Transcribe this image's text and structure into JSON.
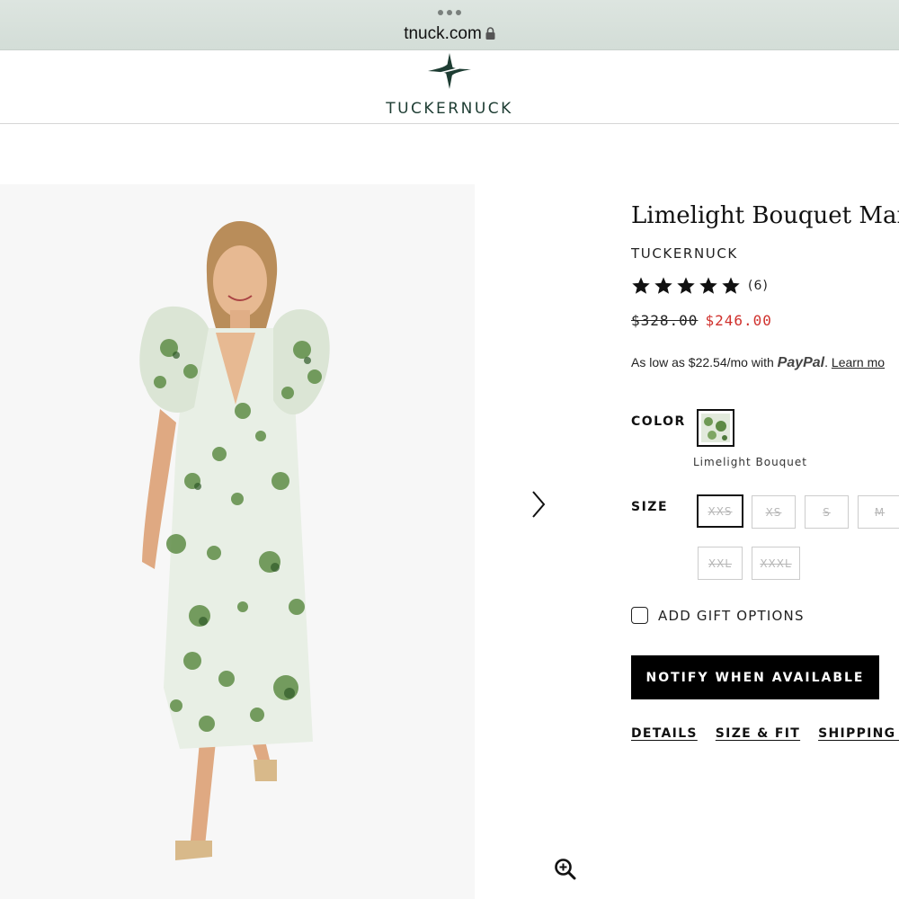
{
  "browser": {
    "url": "tnuck.com"
  },
  "site": {
    "logo_text": "TUCKERNUCK"
  },
  "product": {
    "title": "Limelight Bouquet Mari",
    "brand": "TUCKERNUCK",
    "rating": {
      "stars": 5,
      "count_label": "(6)"
    },
    "price": {
      "original": "$328.00",
      "sale": "$246.00"
    },
    "paypal": {
      "prefix": "As low as $22.54/mo with",
      "brand": "PayPal",
      "sep": ".",
      "link": "Learn mo"
    },
    "color": {
      "label": "COLOR",
      "selected_name": "Limelight Bouquet"
    },
    "size": {
      "label": "SIZE",
      "options": [
        "XXS",
        "XS",
        "S",
        "M",
        "XXL",
        "XXXL"
      ],
      "selected": "XXS"
    },
    "gift_option_label": "ADD GIFT OPTIONS",
    "notify_label": "NOTIFY WHEN AVAILABLE",
    "tabs": [
      "DETAILS",
      "SIZE & FIT",
      "SHIPPING & I"
    ]
  },
  "colors": {
    "sale_red": "#d0312d",
    "brand_green": "#1e3d33",
    "cta_black": "#000000"
  },
  "icons": {
    "lock": "lock-icon",
    "next": "chevron-right-icon",
    "zoom": "zoom-in-icon",
    "star": "star-icon"
  }
}
